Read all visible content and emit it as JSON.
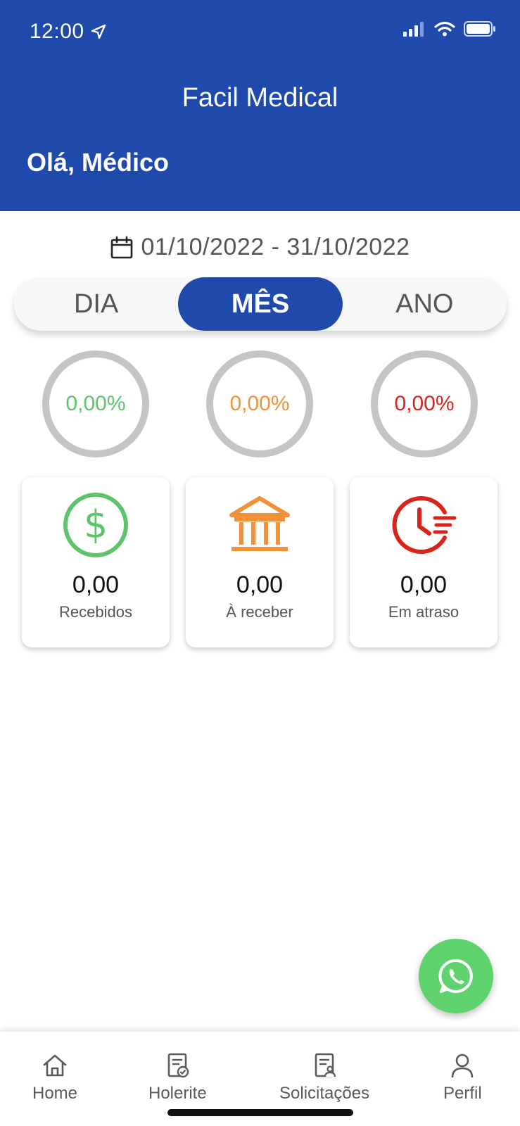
{
  "status_bar": {
    "time": "12:00"
  },
  "header": {
    "app_title": "Facil Medical",
    "greeting": "Olá, Médico"
  },
  "date_range": {
    "text": "01/10/2022 - 31/10/2022",
    "icon": "calendar-icon"
  },
  "period_tabs": [
    {
      "label": "DIA",
      "active": false
    },
    {
      "label": "MÊS",
      "active": true
    },
    {
      "label": "ANO",
      "active": false
    }
  ],
  "rings": [
    {
      "percent_text": "0,00%",
      "color": "#5ec46b",
      "progress": 0
    },
    {
      "percent_text": "0,00%",
      "color": "#f0913b",
      "progress": 0
    },
    {
      "percent_text": "0,00%",
      "color": "#d9241d",
      "progress": 0
    }
  ],
  "cards": [
    {
      "value": "0,00",
      "label": "Recebidos",
      "icon": "dollar-icon",
      "color": "#5ec46b"
    },
    {
      "value": "0,00",
      "label": "À receber",
      "icon": "bank-icon",
      "color": "#f0913b"
    },
    {
      "value": "0,00",
      "label": "Em atraso",
      "icon": "clock-late-icon",
      "color": "#d9241d"
    }
  ],
  "fab": {
    "icon": "whatsapp-icon",
    "color": "#5fd16d"
  },
  "bottom_nav": [
    {
      "label": "Home",
      "icon": "home-icon"
    },
    {
      "label": "Holerite",
      "icon": "payslip-icon"
    },
    {
      "label": "Solicitações",
      "icon": "request-icon"
    },
    {
      "label": "Perfil",
      "icon": "user-icon"
    }
  ],
  "colors": {
    "primary": "#1f49ab",
    "ring_track": "#c4c4c4"
  }
}
